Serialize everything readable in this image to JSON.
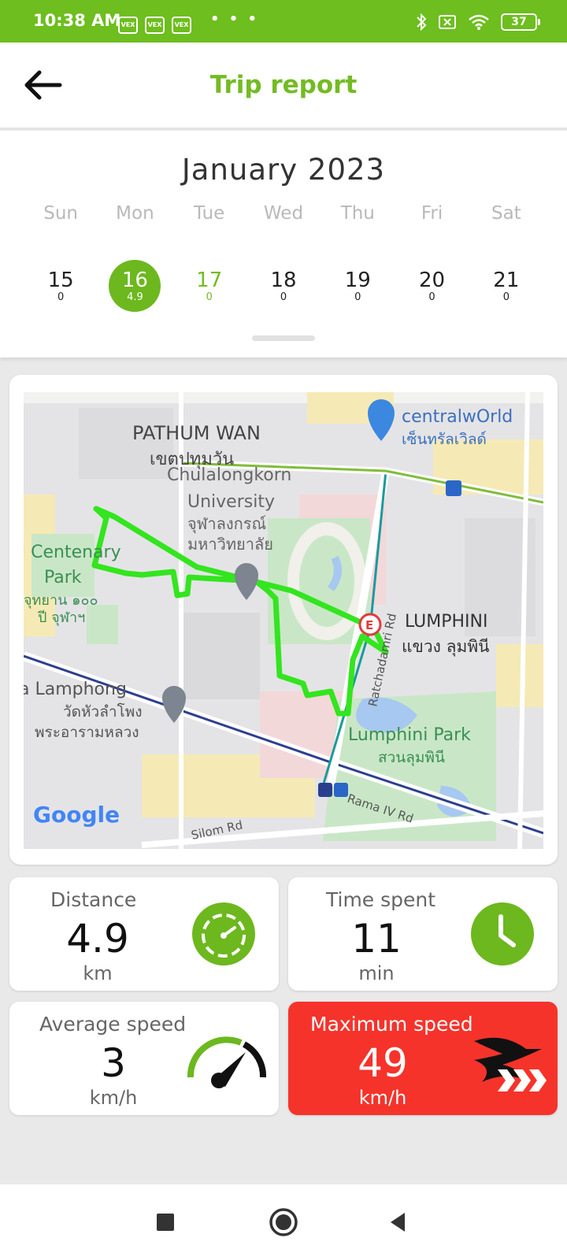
{
  "status_bar": {
    "time": "10:38 AM",
    "apps": [
      "VEX",
      "VEX",
      "VEX"
    ],
    "more": "• • •",
    "battery": "37"
  },
  "header": {
    "title": "Trip report"
  },
  "calendar": {
    "month": "January 2023",
    "weekdays": [
      "Sun",
      "Mon",
      "Tue",
      "Wed",
      "Thu",
      "Fri",
      "Sat"
    ],
    "days": [
      {
        "num": "15",
        "value": "0"
      },
      {
        "num": "16",
        "value": "4.9"
      },
      {
        "num": "17",
        "value": "0"
      },
      {
        "num": "18",
        "value": "0"
      },
      {
        "num": "19",
        "value": "0"
      },
      {
        "num": "20",
        "value": "0"
      },
      {
        "num": "21",
        "value": "0"
      }
    ]
  },
  "map": {
    "labels": {
      "pathum_wan": "PATHUM WAN",
      "pathum_wan_th": "เขตปทุมวัน",
      "chula_1": "Chulalongkorn",
      "chula_2": "University",
      "chula_th_1": "จุฬาลงกรณ์",
      "chula_th_2": "มหาวิทยาลัย",
      "centenary_1": "l Centenary",
      "centenary_2": "Park",
      "centenary_th_1": "จุทยาน ๑๐๐",
      "centenary_th_2": "ปี จุฬาฯ",
      "central": "centralwOrld",
      "central_th": "เซ็นทรัลเวิลด์",
      "lumphini": "LUMPHINI",
      "lumphini_th": "แขวง ลุมพินี",
      "ratchadamri": "Ratchadamri Rd",
      "hua_lamphong_1": "a Lamphong",
      "hua_lamphong_th_1": "วัดหัวลำโพง",
      "hua_lamphong_th_2": "พระอารามหลวง",
      "lumphini_park": "Lumphini Park",
      "lumphini_park_th": "สวนลุมพินี",
      "rama_iv": "Rama IV Rd",
      "silom": "Silom Rd",
      "google": "Google"
    },
    "route_color": "#33e51e"
  },
  "stats": {
    "distance": {
      "label": "Distance",
      "value": "4.9",
      "unit": "km"
    },
    "time": {
      "label": "Time spent",
      "value": "11",
      "unit": "min"
    },
    "avg_speed": {
      "label": "Average speed",
      "value": "3",
      "unit": "km/h"
    },
    "max_speed": {
      "label": "Maximum speed",
      "value": "49",
      "unit": "km/h"
    }
  },
  "colors": {
    "accent": "#6cb81e",
    "danger": "#f5332b"
  }
}
